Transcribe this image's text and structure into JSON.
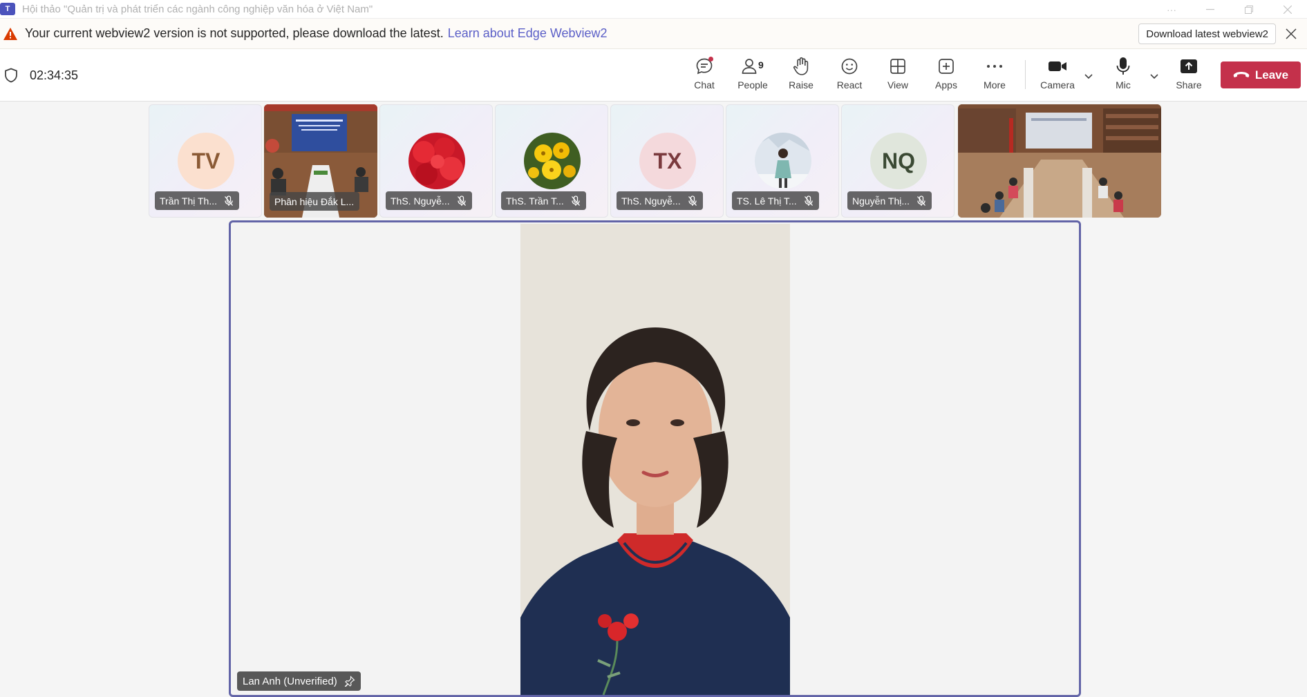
{
  "window": {
    "app_icon": "teams-icon",
    "title": "Hội thảo \"Quản trị và phát triển các ngành công nghiệp văn hóa ở Việt Nam\"",
    "controls": [
      "more-icon",
      "minimize-icon",
      "restore-icon",
      "close-icon"
    ]
  },
  "warning": {
    "message": "Your current webview2 version is not supported, please download the latest.",
    "link": "Learn about Edge Webview2",
    "button": "Download latest webview2"
  },
  "toolbar": {
    "timer": "02:34:35",
    "buttons": {
      "chat": "Chat",
      "people": "People",
      "people_count": "9",
      "raise": "Raise",
      "react": "React",
      "view": "View",
      "apps": "Apps",
      "more": "More",
      "camera": "Camera",
      "mic": "Mic",
      "share": "Share"
    },
    "leave": "Leave"
  },
  "participants": [
    {
      "name": "Trần Thị Th...",
      "initials": "TV",
      "type": "initials",
      "muted": true
    },
    {
      "name": "Phân hiệu Đắk L...",
      "type": "video",
      "muted": false
    },
    {
      "name": "ThS. Nguyễ...",
      "type": "photo",
      "photo": "red-tulips",
      "muted": true
    },
    {
      "name": "ThS. Trần T...",
      "type": "photo",
      "photo": "yellow-flowers",
      "muted": true
    },
    {
      "name": "ThS. Nguyễ...",
      "initials": "TX",
      "type": "initials",
      "muted": true
    },
    {
      "name": "TS. Lê Thị T...",
      "type": "photo",
      "photo": "woman-in-snow",
      "muted": true
    },
    {
      "name": "Nguyễn Thị...",
      "initials": "NQ",
      "type": "initials",
      "muted": true
    },
    {
      "name": "",
      "type": "video",
      "muted": false
    }
  ],
  "main_speaker": {
    "name": "Lan Anh (Unverified)",
    "pinned": true
  },
  "colors": {
    "accent": "#6264a7",
    "leave": "#c4314b",
    "warning": "#da3b01",
    "link": "#5b5fc7"
  }
}
